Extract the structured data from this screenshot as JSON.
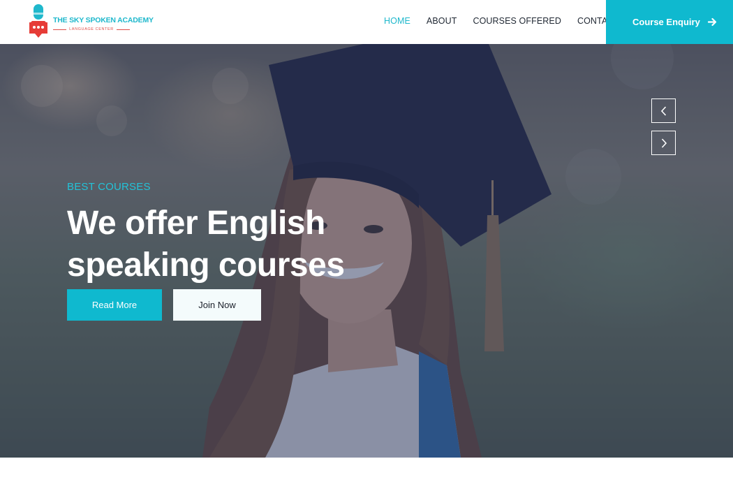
{
  "brand": {
    "title": "THE SKY SPOKEN ACADEMY",
    "subtitle": "LANGUAGE CENTER",
    "logo_icon": "microphone-chat-icon",
    "colors": {
      "primary": "#1fb8cc",
      "accent": "#e04d47"
    }
  },
  "nav": {
    "items": [
      {
        "label": "HOME",
        "active": true
      },
      {
        "label": "ABOUT",
        "active": false
      },
      {
        "label": "COURSES OFFERED",
        "active": false
      },
      {
        "label": "CONTACT",
        "active": false
      }
    ]
  },
  "header": {
    "cta_label": "Course Enquiry",
    "cta_icon": "arrow-right-icon"
  },
  "hero": {
    "eyebrow": "BEST COURSES",
    "headline": "We offer English speaking courses",
    "primary_button": "Read More",
    "secondary_button": "Join Now",
    "prev_icon": "chevron-left-icon",
    "next_icon": "chevron-right-icon"
  }
}
